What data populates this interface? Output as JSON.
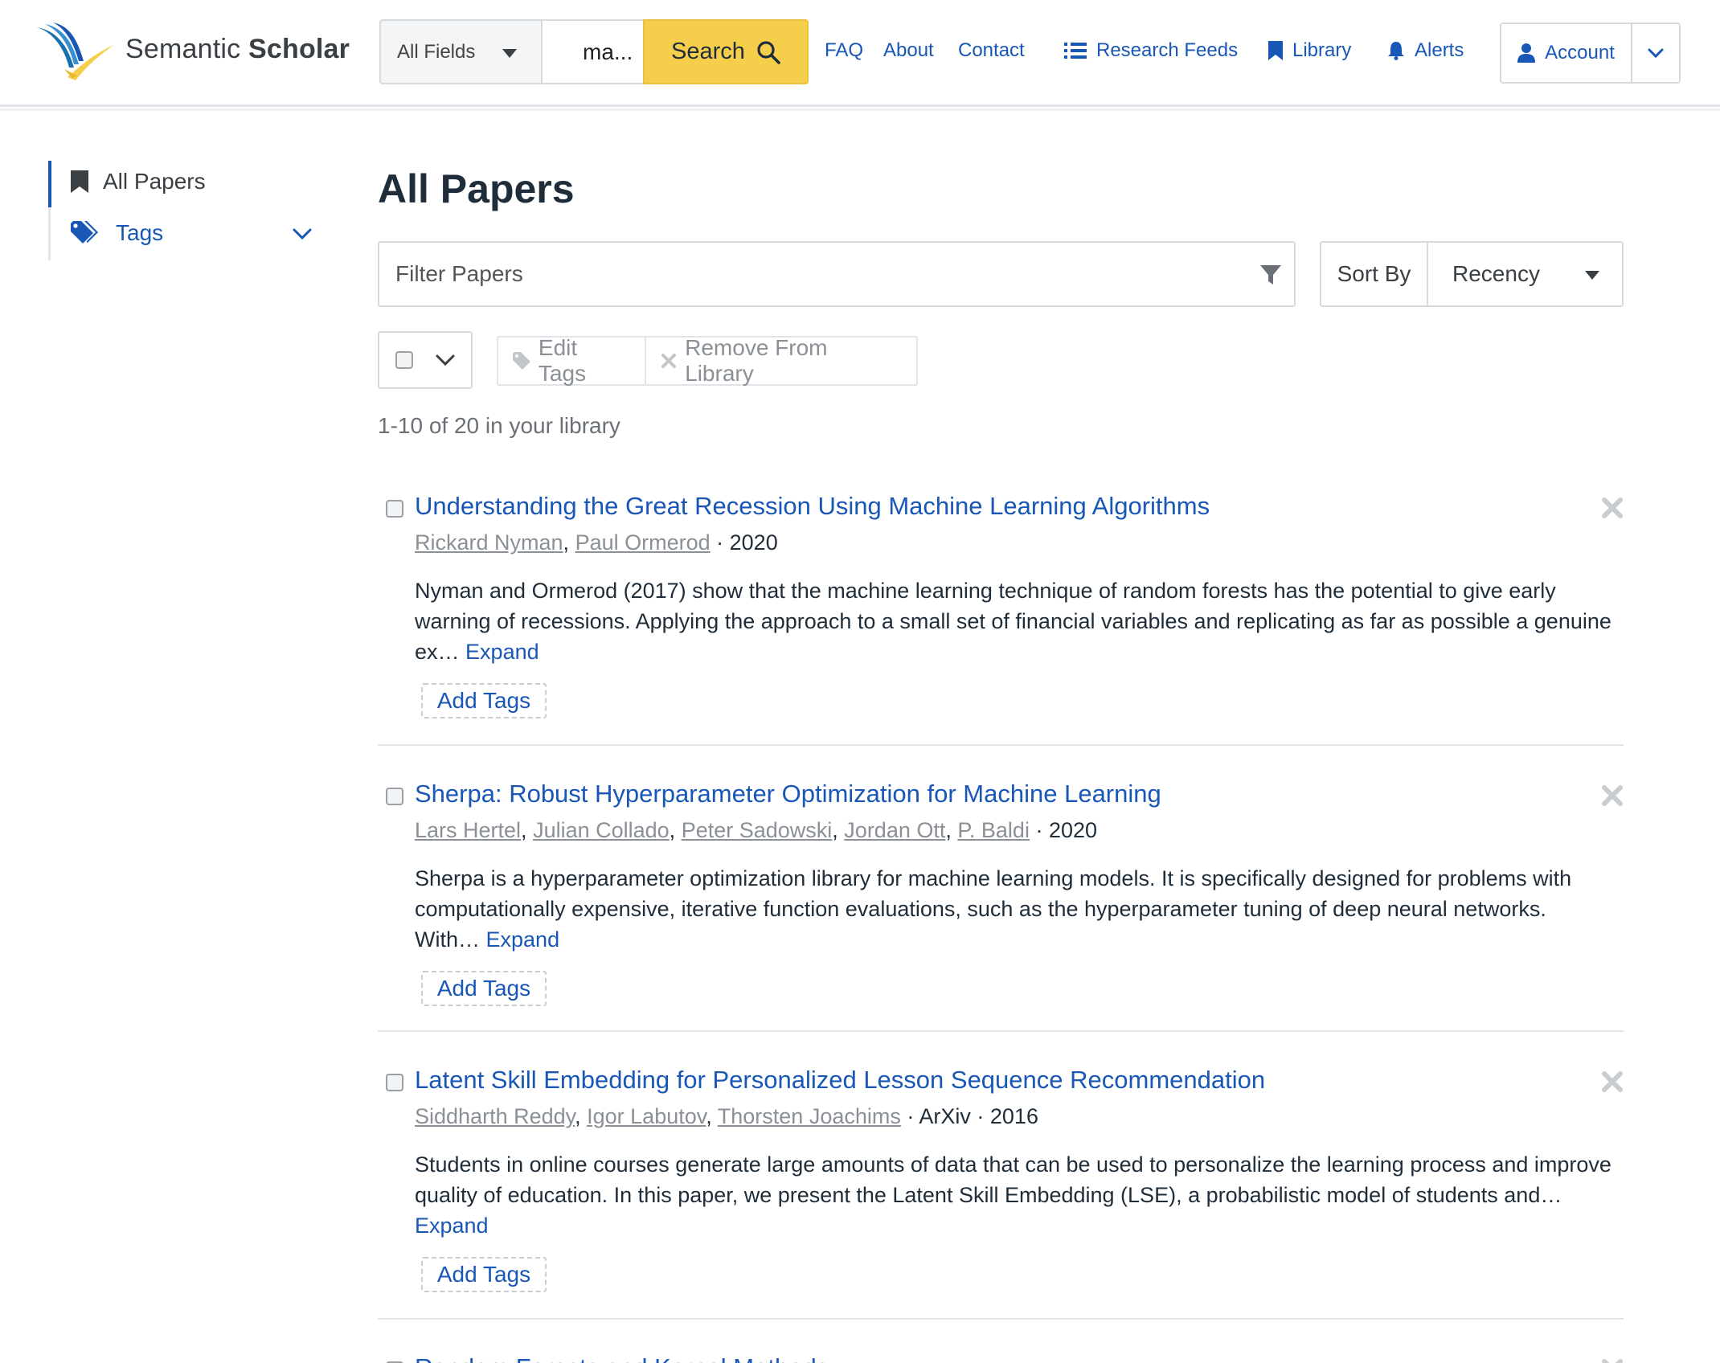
{
  "brand": {
    "name_light": "Semantic",
    "name_bold": "Scholar"
  },
  "search": {
    "field": "All Fields",
    "query": "ma...",
    "button_label": "Search"
  },
  "nav": {
    "faq": "FAQ",
    "about": "About",
    "contact": "Contact",
    "research_feeds": "Research Feeds",
    "library": "Library",
    "alerts": "Alerts",
    "account": "Account"
  },
  "sidebar": {
    "items": [
      {
        "label": "All Papers",
        "icon": "bookmark-icon",
        "active": true
      },
      {
        "label": "Tags",
        "icon": "tags-icon",
        "active": false
      }
    ]
  },
  "main": {
    "title": "All Papers",
    "filter_placeholder": "Filter Papers",
    "sort_label": "Sort By",
    "sort_value": "Recency",
    "edit_tags": "Edit Tags",
    "remove_from_library": "Remove From Library",
    "count_text": "1-10 of 20 in your library",
    "add_tags_label": "Add Tags",
    "expand_label": "Expand"
  },
  "papers": [
    {
      "title": "Understanding the Great Recession Using Machine Learning Algorithms",
      "authors": [
        "Rickard Nyman",
        "Paul Ormerod"
      ],
      "venue": "",
      "year": "2020",
      "abstract": "Nyman and Ormerod (2017) show that the machine learning technique of random forests has the potential to give early warning of recessions. Applying the approach to a small set of financial variables and replicating as far as possible a genuine ex…"
    },
    {
      "title": "Sherpa: Robust Hyperparameter Optimization for Machine Learning",
      "authors": [
        "Lars Hertel",
        "Julian Collado",
        "Peter Sadowski",
        "Jordan Ott",
        "P. Baldi"
      ],
      "venue": "",
      "year": "2020",
      "abstract": "Sherpa is a hyperparameter optimization library for machine learning models. It is specifically designed for problems with computationally expensive, iterative function evaluations, such as the hyperparameter tuning of deep neural networks. With…"
    },
    {
      "title": "Latent Skill Embedding for Personalized Lesson Sequence Recommendation",
      "authors": [
        "Siddharth Reddy",
        "Igor Labutov",
        "Thorsten Joachims"
      ],
      "venue": "ArXiv",
      "year": "2016",
      "abstract": "Students in online courses generate large amounts of data that can be used to personalize the learning process and improve quality of education. In this paper, we present the Latent Skill Embedding (LSE), a probabilistic model of students and…"
    },
    {
      "title": "Random Forests and Kernel Methods",
      "authors": [],
      "venue": "",
      "year": "",
      "abstract": ""
    }
  ],
  "colors": {
    "link": "#1857b6",
    "search_button": "#f5cf4b",
    "muted": "#8a9096",
    "text": "#1f2d3a"
  }
}
